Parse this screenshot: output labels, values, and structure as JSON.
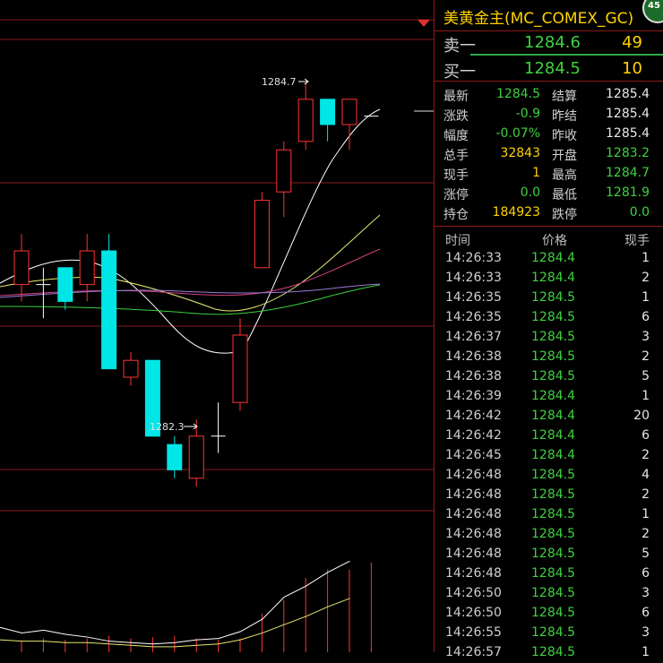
{
  "instrument": {
    "title": "美黄金主(MC_COMEX_GC)",
    "badge": "45"
  },
  "orderbook": {
    "sell": {
      "label": "卖一",
      "price": "1284.6",
      "volume": "49"
    },
    "buy": {
      "label": "买一",
      "price": "1284.5",
      "volume": "10"
    }
  },
  "quote": [
    {
      "l1": "最新",
      "v1": "1284.5",
      "c1": "g",
      "l2": "结算",
      "v2": "1285.4",
      "c2": "w"
    },
    {
      "l1": "涨跌",
      "v1": "-0.9",
      "c1": "g",
      "l2": "昨结",
      "v2": "1285.4",
      "c2": "w"
    },
    {
      "l1": "幅度",
      "v1": "-0.07%",
      "c1": "g",
      "l2": "昨收",
      "v2": "1285.4",
      "c2": "w"
    },
    {
      "l1": "总手",
      "v1": "32843",
      "c1": "y",
      "l2": "开盘",
      "v2": "1283.2",
      "c2": "g"
    },
    {
      "l1": "现手",
      "v1": "1",
      "c1": "y",
      "l2": "最高",
      "v2": "1284.7",
      "c2": "g"
    },
    {
      "l1": "涨停",
      "v1": "0.0",
      "c1": "g",
      "l2": "最低",
      "v2": "1281.9",
      "c2": "g"
    },
    {
      "l1": "持仓",
      "v1": "184923",
      "c1": "y",
      "l2": "跌停",
      "v2": "0.0",
      "c2": "g"
    }
  ],
  "ticks_header": {
    "time": "时间",
    "price": "价格",
    "volume": "现手"
  },
  "ticks": [
    {
      "time": "14:26:33",
      "price": "1284.4",
      "volume": "1"
    },
    {
      "time": "14:26:33",
      "price": "1284.4",
      "volume": "2"
    },
    {
      "time": "14:26:35",
      "price": "1284.5",
      "volume": "1"
    },
    {
      "time": "14:26:35",
      "price": "1284.5",
      "volume": "6"
    },
    {
      "time": "14:26:37",
      "price": "1284.5",
      "volume": "3"
    },
    {
      "time": "14:26:38",
      "price": "1284.5",
      "volume": "2"
    },
    {
      "time": "14:26:38",
      "price": "1284.5",
      "volume": "5"
    },
    {
      "time": "14:26:39",
      "price": "1284.4",
      "volume": "1"
    },
    {
      "time": "14:26:42",
      "price": "1284.4",
      "volume": "20"
    },
    {
      "time": "14:26:42",
      "price": "1284.4",
      "volume": "6"
    },
    {
      "time": "14:26:45",
      "price": "1284.4",
      "volume": "2"
    },
    {
      "time": "14:26:48",
      "price": "1284.5",
      "volume": "4"
    },
    {
      "time": "14:26:48",
      "price": "1284.5",
      "volume": "2"
    },
    {
      "time": "14:26:48",
      "price": "1284.5",
      "volume": "1"
    },
    {
      "time": "14:26:48",
      "price": "1284.5",
      "volume": "2"
    },
    {
      "time": "14:26:48",
      "price": "1284.5",
      "volume": "5"
    },
    {
      "time": "14:26:48",
      "price": "1284.5",
      "volume": "6"
    },
    {
      "time": "14:26:50",
      "price": "1284.5",
      "volume": "3"
    },
    {
      "time": "14:26:50",
      "price": "1284.5",
      "volume": "6"
    },
    {
      "time": "14:26:55",
      "price": "1284.5",
      "volume": "3"
    },
    {
      "time": "14:26:57",
      "price": "1284.5",
      "volume": "1"
    }
  ],
  "kline": {
    "high_label": "1284.7",
    "low_label": "1282.3",
    "colors": {
      "up": "#ff3333",
      "down": "#00e6e6",
      "grid": "#8a1a1a"
    },
    "candles": [
      {
        "o": 1283.5,
        "c": 1283.7,
        "h": 1283.8,
        "l": 1283.4
      },
      {
        "o": 1283.5,
        "c": 1283.5,
        "h": 1283.6,
        "l": 1283.3
      },
      {
        "o": 1283.6,
        "c": 1283.4,
        "h": 1283.6,
        "l": 1283.35
      },
      {
        "o": 1283.5,
        "c": 1283.7,
        "h": 1283.8,
        "l": 1283.4
      },
      {
        "o": 1283.7,
        "c": 1283.0,
        "h": 1283.8,
        "l": 1283.0
      },
      {
        "o": 1282.95,
        "c": 1283.05,
        "h": 1283.1,
        "l": 1282.9
      },
      {
        "o": 1283.05,
        "c": 1282.6,
        "h": 1283.05,
        "l": 1282.6
      },
      {
        "o": 1282.55,
        "c": 1282.4,
        "h": 1282.6,
        "l": 1282.35
      },
      {
        "o": 1282.35,
        "c": 1282.6,
        "h": 1282.7,
        "l": 1282.3
      },
      {
        "o": 1282.6,
        "c": 1282.6,
        "h": 1282.8,
        "l": 1282.5
      },
      {
        "o": 1282.8,
        "c": 1283.2,
        "h": 1283.3,
        "l": 1282.75
      },
      {
        "o": 1283.6,
        "c": 1284.0,
        "h": 1284.05,
        "l": 1283.6
      },
      {
        "o": 1284.05,
        "c": 1284.3,
        "h": 1284.35,
        "l": 1283.9
      },
      {
        "o": 1284.35,
        "c": 1284.6,
        "h": 1284.7,
        "l": 1284.3
      },
      {
        "o": 1284.6,
        "c": 1284.45,
        "h": 1284.6,
        "l": 1284.35
      },
      {
        "o": 1284.45,
        "c": 1284.6,
        "h": 1284.6,
        "l": 1284.3
      },
      {
        "o": 1284.5,
        "c": 1284.5,
        "h": 1284.5,
        "l": 1284.5
      }
    ],
    "volume_white": [
      0.82,
      0.86,
      0.84,
      0.87,
      0.89,
      0.92,
      0.93,
      0.94,
      0.93,
      0.91,
      0.9,
      0.85,
      0.76,
      0.6,
      0.52,
      0.42,
      0.34
    ],
    "volume_yellow": [
      0.91,
      0.92,
      0.92,
      0.93,
      0.93,
      0.94,
      0.95,
      0.96,
      0.96,
      0.95,
      0.94,
      0.91,
      0.86,
      0.8,
      0.74,
      0.67,
      0.61
    ],
    "volume_bars": [
      0.08,
      0.1,
      0.09,
      0.1,
      0.12,
      0.1,
      0.11,
      0.12,
      0.1,
      0.09,
      0.1,
      0.28,
      0.38,
      0.54,
      0.6,
      0.6,
      0.65
    ]
  }
}
